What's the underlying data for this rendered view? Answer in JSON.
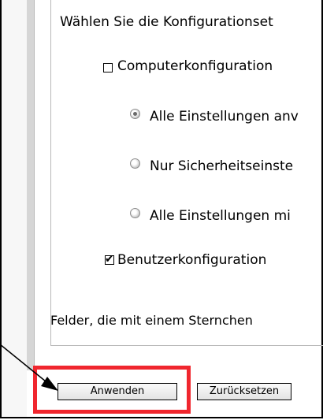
{
  "form": {
    "config_heading": "Wählen Sie die Konfigurationset",
    "computer_config_label": "Computerkonfiguration",
    "computer_config_checked": false,
    "radio_all_settings_apply": "Alle Einstellungen anv",
    "radio_security_only": "Nur Sicherheitseinste",
    "radio_all_settings_with": "Alle Einstellungen mi",
    "selected_radio": "radio_all_settings_apply",
    "user_config_label": "Benutzerkonfiguration",
    "user_config_checked": true,
    "required_note": "Felder, die mit einem Sternchen"
  },
  "buttons": {
    "apply_label": "Anwenden",
    "reset_label": "Zurücksetzen"
  },
  "colors": {
    "highlight": "#f0262e",
    "arrow": "#000000"
  }
}
